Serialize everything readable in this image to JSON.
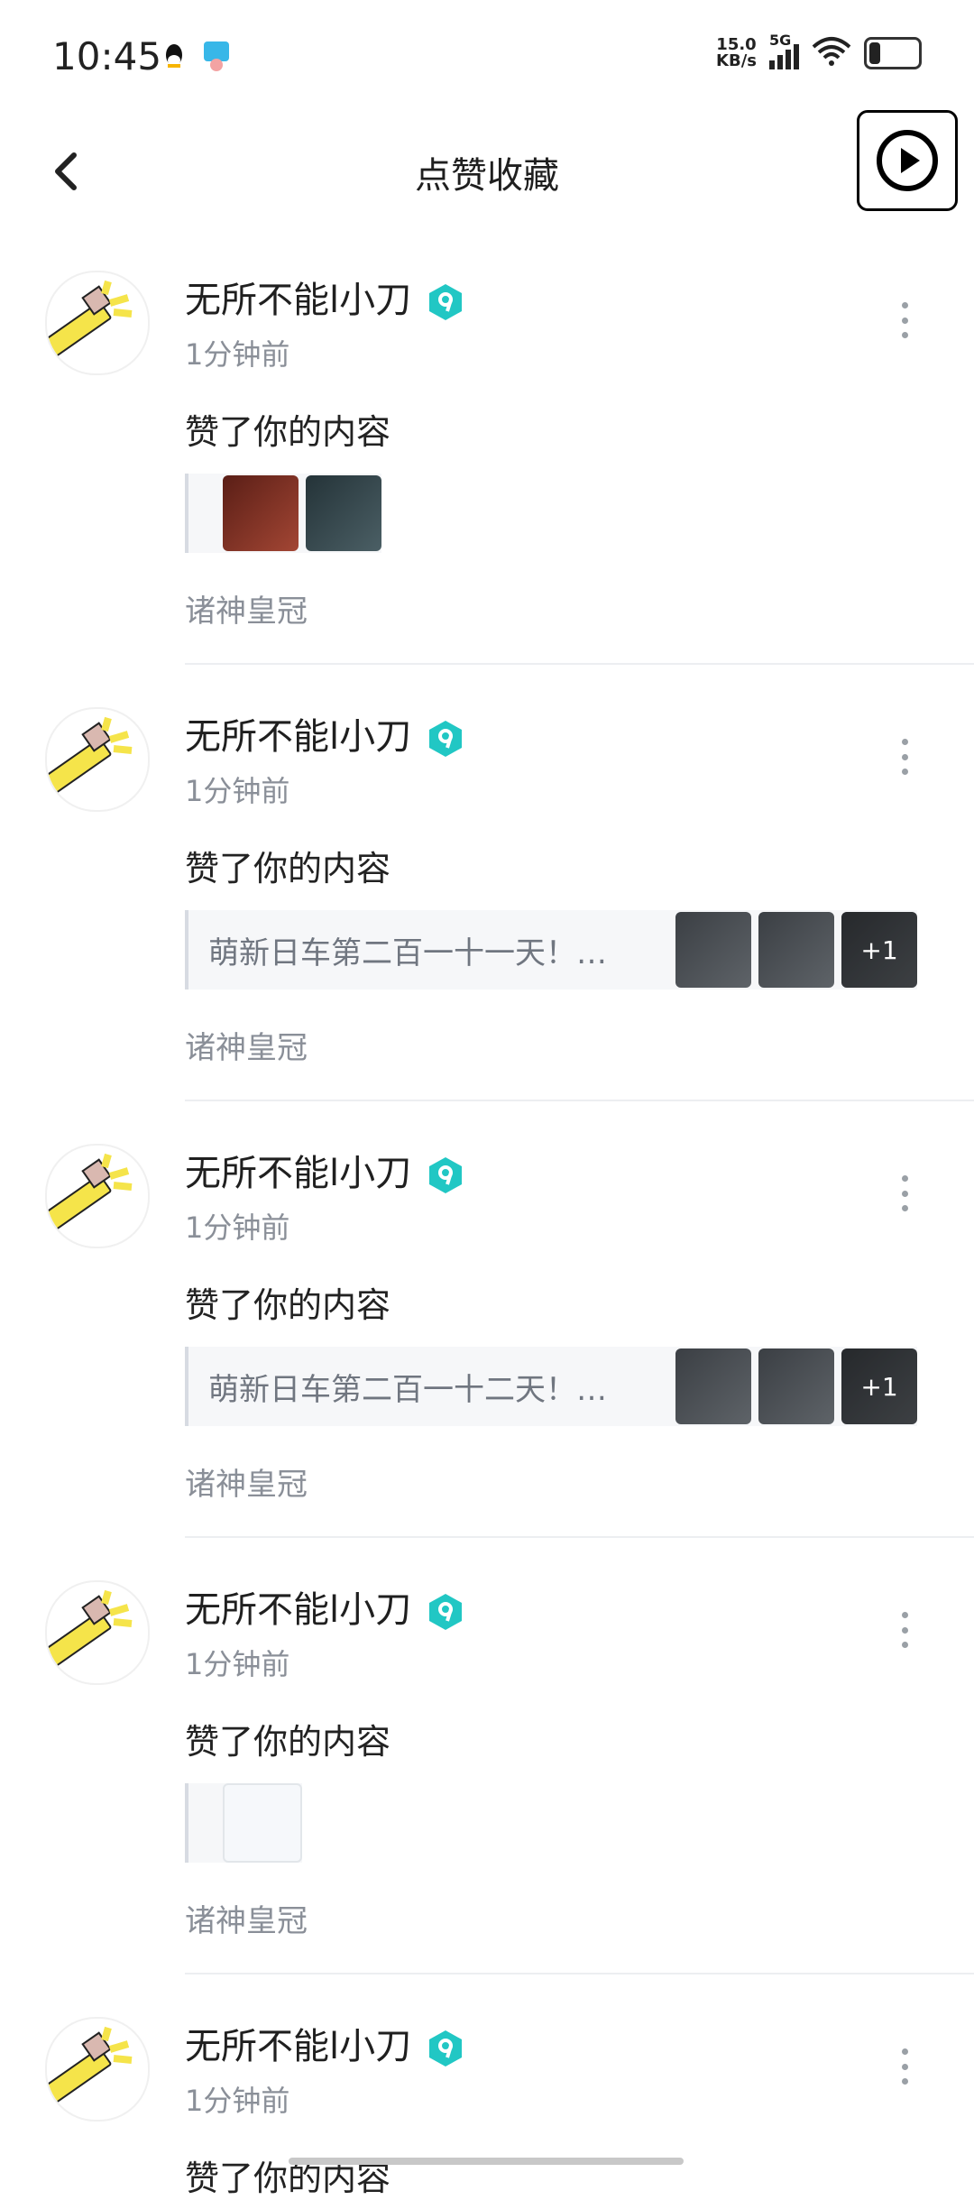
{
  "statusbar": {
    "time": "10:45",
    "netspeed_value": "15.0",
    "netspeed_unit": "KB/s",
    "network": "5G"
  },
  "header": {
    "title": "点赞收藏"
  },
  "items": [
    {
      "username": "无所不能l小刀",
      "time": "1分钟前",
      "action": "赞了你的内容",
      "source": "诸神皇冠",
      "preview_text": "",
      "thumbnails": [
        "red",
        "green"
      ]
    },
    {
      "username": "无所不能l小刀",
      "time": "1分钟前",
      "action": "赞了你的内容",
      "source": "诸神皇冠",
      "preview_text": "萌新日车第二百一十一天！…",
      "thumbnails": [
        "dark",
        "dark",
        "dark"
      ],
      "more": "+1"
    },
    {
      "username": "无所不能l小刀",
      "time": "1分钟前",
      "action": "赞了你的内容",
      "source": "诸神皇冠",
      "preview_text": "萌新日车第二百一十二天！…",
      "thumbnails": [
        "dark",
        "dark",
        "dark"
      ],
      "more": "+1"
    },
    {
      "username": "无所不能l小刀",
      "time": "1分钟前",
      "action": "赞了你的内容",
      "source": "诸神皇冠",
      "preview_text": "",
      "thumbnails": [
        "light"
      ]
    },
    {
      "username": "无所不能l小刀",
      "time": "1分钟前",
      "action": "赞了你的内容",
      "source": "",
      "preview_text": "",
      "thumbnails": []
    }
  ],
  "colors": {
    "accent": "#21c7c4",
    "muted": "#8a8f98"
  }
}
